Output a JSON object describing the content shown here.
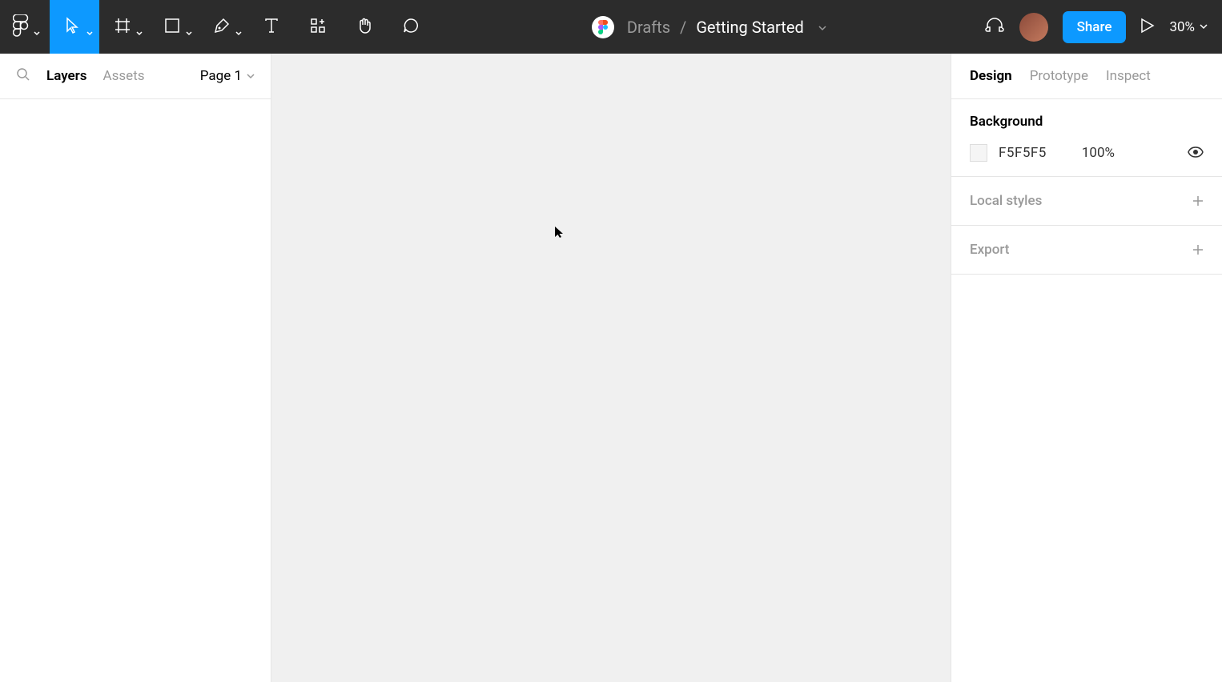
{
  "toolbar": {
    "breadcrumb_folder": "Drafts",
    "breadcrumb_separator": "/",
    "breadcrumb_file": "Getting Started",
    "share_label": "Share",
    "zoom_value": "30%"
  },
  "left_panel": {
    "tabs": {
      "layers": "Layers",
      "assets": "Assets"
    },
    "page_label": "Page 1"
  },
  "right_panel": {
    "tabs": {
      "design": "Design",
      "prototype": "Prototype",
      "inspect": "Inspect"
    },
    "background": {
      "title": "Background",
      "hex": "F5F5F5",
      "opacity": "100%"
    },
    "local_styles": {
      "title": "Local styles"
    },
    "export": {
      "title": "Export"
    }
  }
}
